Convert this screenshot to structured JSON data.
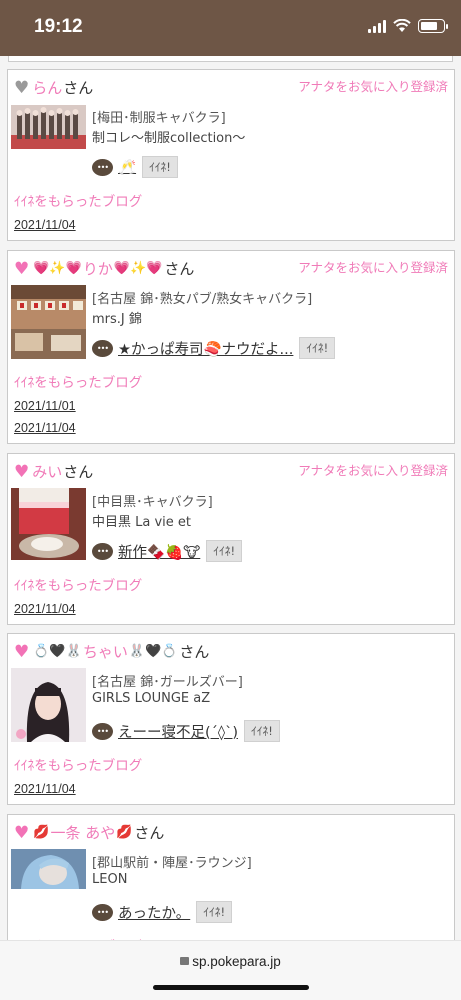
{
  "status": {
    "time": "19:12"
  },
  "common": {
    "san": "さん",
    "fav_label": "アナタをお気に入り登録済",
    "iine_label": "ｲｲﾈ!",
    "got_blog_label": "ｲｲﾈをもらったブログ"
  },
  "cards": [
    {
      "name": "らん",
      "category": "[梅田･制服キャバクラ]",
      "shop": "制コレ〜制服collection〜",
      "blog_title": "🥂",
      "dates": [
        "2021/11/04"
      ]
    },
    {
      "name_prefix": "💗✨💗",
      "name": "りか",
      "name_suffix": "💗✨💗",
      "category": "[名古屋 錦･熟女パブ/熟女キャバクラ]",
      "shop": "mrs.J 錦",
      "blog_title": "★かっぱ寿司🍣ナウだよ...",
      "dates": [
        "2021/11/01",
        "2021/11/04"
      ]
    },
    {
      "name": "みい",
      "category": "[中目黒･キャバクラ]",
      "shop": "中目黒 La vie et",
      "blog_title": "新作🍫🍓🐮",
      "dates": [
        "2021/11/04"
      ]
    },
    {
      "name_prefix": "💍🖤🐰",
      "name": "ちゃい",
      "name_suffix": "🐰🖤💍",
      "category": "[名古屋 錦･ガールズバー]",
      "shop": "GIRLS LOUNGE aZ",
      "blog_title": "えーー寝不足(´◊`)",
      "dates": [
        "2021/11/04"
      ]
    },
    {
      "name_prefix": "💋",
      "name": "一条 あや",
      "name_suffix": "💋",
      "category": "[郡山駅前・陣屋･ラウンジ]",
      "shop": "LEON",
      "blog_title": "あったか。"
    }
  ],
  "browser": {
    "url": "sp.pokepara.jp"
  }
}
